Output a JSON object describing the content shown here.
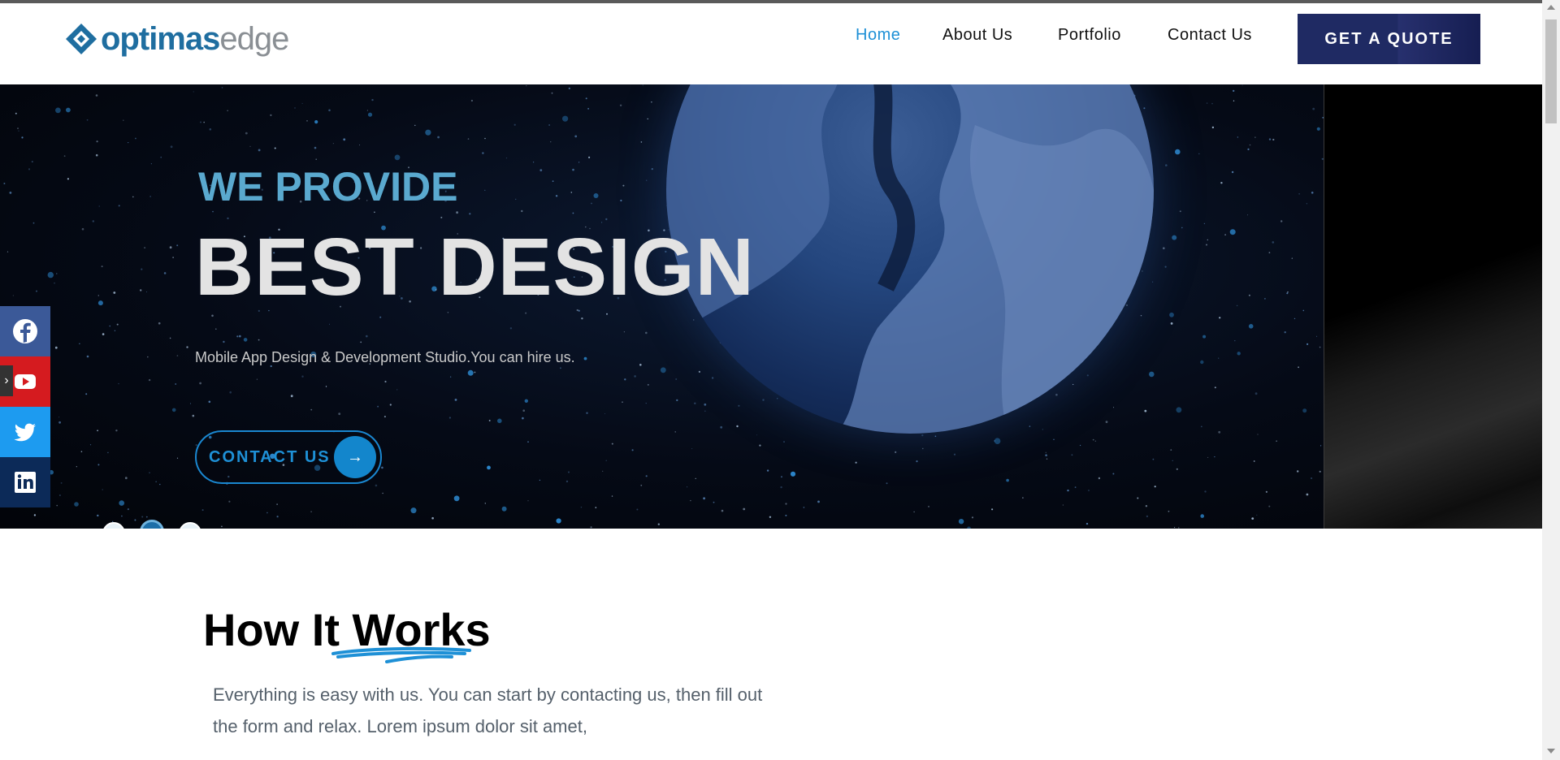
{
  "brand": {
    "logo_primary": "optimas",
    "logo_secondary": "edge",
    "primary_color": "#1f6ea0",
    "secondary_color": "#8a8f94"
  },
  "nav": {
    "items": [
      {
        "label": "Home",
        "active": true
      },
      {
        "label": "About Us",
        "active": false
      },
      {
        "label": "Portfolio",
        "active": false
      },
      {
        "label": "Contact Us",
        "active": false
      }
    ],
    "cta_label": "GET A QUOTE",
    "active_color": "#1e90d6",
    "cta_color": "#1f2a63"
  },
  "hero": {
    "kicker": "WE PROVIDE",
    "title": "BEST DESIGN",
    "subtitle": "Mobile App Design & Development Studio.You can hire us.",
    "cta_label": "CONTACT US",
    "cta_icon": "arrow-right-icon",
    "slide_count": 3,
    "active_slide": 2,
    "accent_color": "#1386cc"
  },
  "social": {
    "items": [
      {
        "name": "facebook",
        "icon": "facebook-icon",
        "color": "#3b5998"
      },
      {
        "name": "youtube",
        "icon": "youtube-icon",
        "color": "#d51b1f"
      },
      {
        "name": "twitter",
        "icon": "twitter-icon",
        "color": "#1d9bf0"
      },
      {
        "name": "linkedin",
        "icon": "linkedin-icon",
        "color": "#0c2a58"
      }
    ],
    "toggle_icon": "chevron-right-icon"
  },
  "how_it_works": {
    "title_part1": "How It",
    "title_part2": "Works",
    "description": "Everything is easy with us. You can start by contacting us, then fill out the form and relax. Lorem ipsum dolor sit amet,",
    "underline_color": "#1e90d6"
  }
}
